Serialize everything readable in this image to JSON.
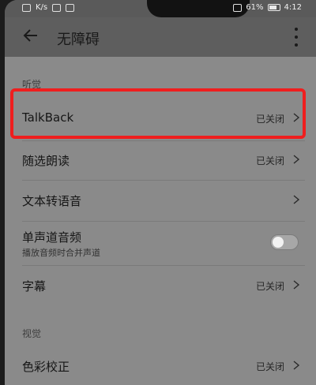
{
  "statusbar": {
    "carrier": "K/s",
    "battery": "61%",
    "time": "4:12"
  },
  "header": {
    "title": "无障碍"
  },
  "sections": {
    "hearing": "听觉",
    "vision": "视觉"
  },
  "rows": {
    "talkback": {
      "label": "TalkBack",
      "value": "已关闭"
    },
    "select_to_speak": {
      "label": "随选朗读",
      "value": "已关闭"
    },
    "tts": {
      "label": "文本转语音"
    },
    "mono_audio": {
      "label": "单声道音频",
      "subtitle": "播放音频时合并声道",
      "enabled": false
    },
    "captions": {
      "label": "字幕",
      "value": "已关闭"
    },
    "color_correction": {
      "label": "色彩校正",
      "value": "已关闭"
    }
  },
  "colors": {
    "highlight": "#ef1e1e"
  },
  "icons": {
    "back": "arrow-left-icon",
    "more": "more-vertical-icon",
    "chevron": "chevron-right-icon"
  }
}
